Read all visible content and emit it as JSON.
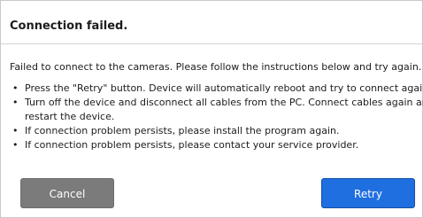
{
  "dialog": {
    "title": "Connection failed.",
    "message": "Failed to connect to the cameras. Please follow the instructions below and try again.",
    "instructions": [
      {
        "line1": "Press the \"Retry\" button. Device will automatically reboot and try to connect again.",
        "line2": ""
      },
      {
        "line1": "Turn off the device and disconnect all cables from the PC. Connect cables again and",
        "line2": "restart the device."
      },
      {
        "line1": "If connection problem persists, please install the program again.",
        "line2": ""
      },
      {
        "line1": "If connection problem persists, please contact your service provider.",
        "line2": ""
      }
    ],
    "bullet": "•",
    "buttons": {
      "cancel_label": "Cancel",
      "retry_label": "Retry"
    }
  },
  "colors": {
    "cancel_button": "#7b7b7b",
    "retry_button": "#1f6fe0",
    "text": "#1c1c1c",
    "border": "#c9c9c9"
  }
}
